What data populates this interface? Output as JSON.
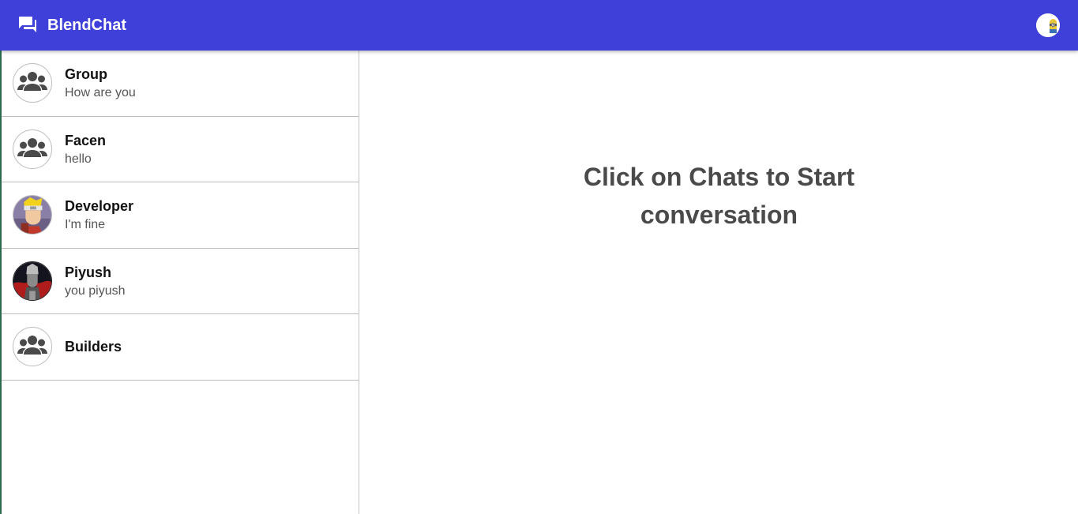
{
  "app": {
    "title": "BlendChat",
    "brand_icon": "forum-icon",
    "accent_color": "#3f3fd9",
    "user_avatar": "profile-avatar"
  },
  "sidebar": {
    "chats": [
      {
        "name": "Group",
        "last_message": "How are you",
        "avatar": "group-icon"
      },
      {
        "name": "Facen",
        "last_message": "hello",
        "avatar": "group-icon"
      },
      {
        "name": "Developer",
        "last_message": "I'm fine",
        "avatar": "user-photo"
      },
      {
        "name": "Piyush",
        "last_message": "you piyush",
        "avatar": "user-photo"
      },
      {
        "name": "Builders",
        "last_message": "",
        "avatar": "group-icon"
      }
    ]
  },
  "main": {
    "placeholder_line1": "Click on Chats to Start",
    "placeholder_line2": "conversation"
  }
}
